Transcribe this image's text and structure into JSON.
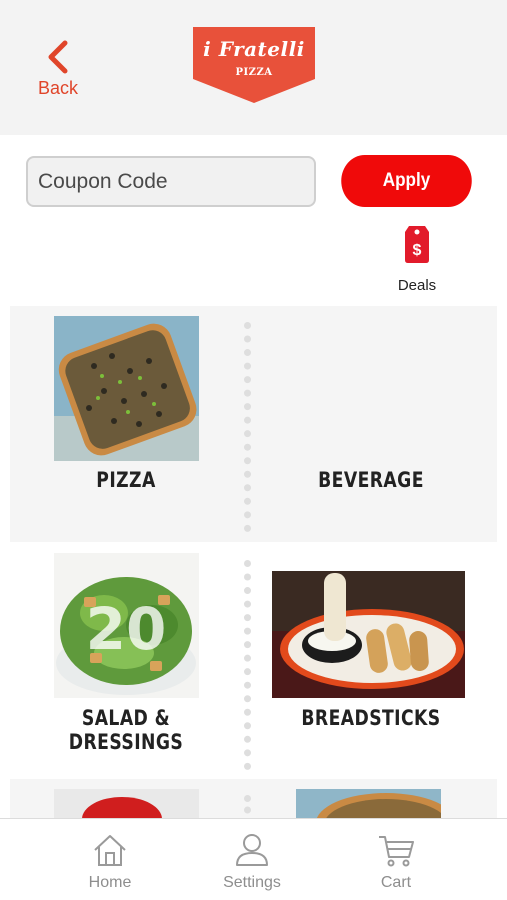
{
  "header": {
    "back_label": "Back",
    "logo_script": "i Fratelli",
    "logo_sub": "PIZZA",
    "accent_color": "#e0452a"
  },
  "coupon": {
    "placeholder": "Coupon Code",
    "value": "",
    "apply_label": "Apply",
    "apply_color": "#f00a0a"
  },
  "deals": {
    "label": "Deals",
    "icon": "price-tag-dollar-icon"
  },
  "categories": [
    {
      "label": "PIZZA",
      "image": "pizza-photo"
    },
    {
      "label": "BEVERAGE",
      "image": ""
    },
    {
      "label": "SALAD & DRESSINGS",
      "image": "salad-photo"
    },
    {
      "label": "BREADSTICKS",
      "image": "breadsticks-photo"
    }
  ],
  "tabbar": {
    "items": [
      {
        "label": "Home",
        "icon": "home-icon"
      },
      {
        "label": "Settings",
        "icon": "person-icon"
      },
      {
        "label": "Cart",
        "icon": "cart-icon"
      }
    ]
  }
}
